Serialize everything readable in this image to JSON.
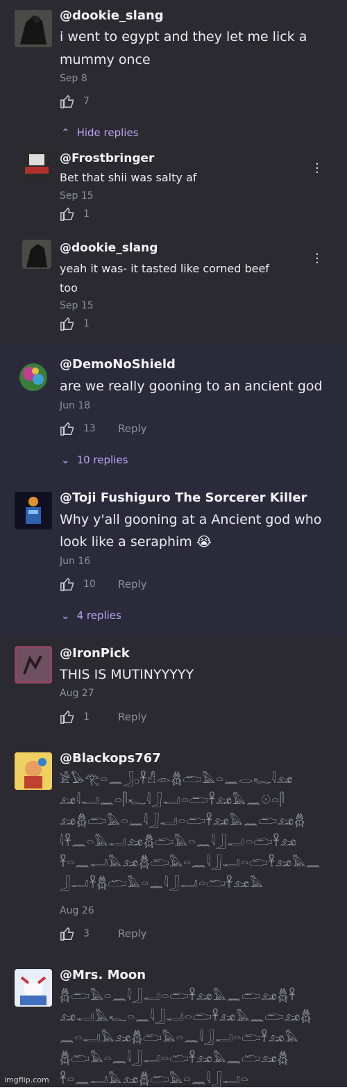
{
  "comments": [
    {
      "username": "@dookie_slang",
      "text1": "i went to egypt and they let me lick a",
      "text2": "mummy once",
      "date": "Sep 8",
      "likes": "7"
    },
    {
      "username": "@DemoNoShield",
      "text1": "are we really gooning to an ancient god",
      "date": "Jun 18",
      "likes": "13",
      "reply": "Reply"
    },
    {
      "username": "@Toji Fushiguro The Sorcerer Killer",
      "text1": "Why y'all gooning at a Ancient god who",
      "text2": "look like a seraphim 😭",
      "date": "Jun 16",
      "likes": "10",
      "reply": "Reply"
    },
    {
      "username": "@IronPick",
      "text1": "THIS IS MUTINYYYYY",
      "date": "Aug 27",
      "likes": "1",
      "reply": "Reply"
    },
    {
      "username": "@Blackops767",
      "date": "Aug 26",
      "likes": "3",
      "reply": "Reply",
      "glyph_lines": [
        "𓀀𓅃𓂀𓏏𓈖𓃀𓊪𓋹𓀭𓁹𓆣𓂧𓅓𓏏𓈖𓂋𓆑𓇋𓃭",
        "𓃭𓇋𓂝𓈖𓏏𓋴𓆑𓇋𓃀𓂝𓏏𓂧𓋹𓃭𓅓𓈖𓇳𓏏𓋴",
        "𓃭𓆣𓂧𓅓𓏏𓈖𓇋𓃀𓂝𓏏𓂧𓋹𓃭𓅓𓈖𓂧𓃭𓆣",
        "𓇋𓋹𓈖𓏏𓅓𓂝𓃭𓆣𓂧𓅓𓏏𓈖𓇋𓃀𓂝𓏏𓂧𓋹𓃭",
        "𓋹𓏏𓈖𓂝𓅓𓃭𓆣𓂧𓅓𓏏𓈖𓇋𓃀𓂝𓏏𓂧𓋹𓃭𓅓𓈖",
        "𓃀𓂝𓋹𓆣𓂧𓅓𓏏𓈖𓇋𓃀𓂝𓏏𓂧𓋹𓃭𓅓"
      ]
    },
    {
      "username": "@Mrs. Moon",
      "glyph_lines": [
        "𓆣𓂧𓅓𓏏𓈖𓇋𓃀𓂝𓏏𓂧𓋹𓃭𓅓𓈖𓂧𓃭𓆣𓋹",
        "𓃭𓂝𓅓𓆑𓏏𓈖𓇋𓃀𓂝𓏏𓂧𓋹𓃭𓅓𓈖𓂧𓃭𓆣",
        "𓈖𓏏𓂝𓅓𓃭𓆣𓂧𓅓𓏏𓈖𓇋𓃀𓂝𓏏𓂧𓋹𓃭𓅓",
        "𓆣𓂧𓅓𓏏𓈖𓇋𓃀𓂝𓏏𓂧𓋹𓃭𓅓𓈖𓂧𓃭𓆣",
        "𓋹𓏏𓈖𓂝𓅓𓃭𓆣𓂧𓅓𓏏𓈖𓇋𓃀𓂝𓏏"
      ]
    }
  ],
  "replies": [
    {
      "username": "@Frostbringer",
      "text1": "Bet that shii was salty af",
      "date": "Sep 15",
      "likes": "1"
    },
    {
      "username": "@dookie_slang",
      "text1": "yeah it was- it tasted like corned beef",
      "text2": "too",
      "date": "Sep 15",
      "likes": "1"
    }
  ],
  "toggles": {
    "hide": "Hide replies",
    "ten": "10 replies",
    "four": "4 replies"
  },
  "watermark": "imgflip.com",
  "colors": {
    "accent": "#b9a6f5",
    "muted": "#8f8ea0",
    "bg_dark": "#2a2a30",
    "bg_purple": "#2b2a3a"
  }
}
